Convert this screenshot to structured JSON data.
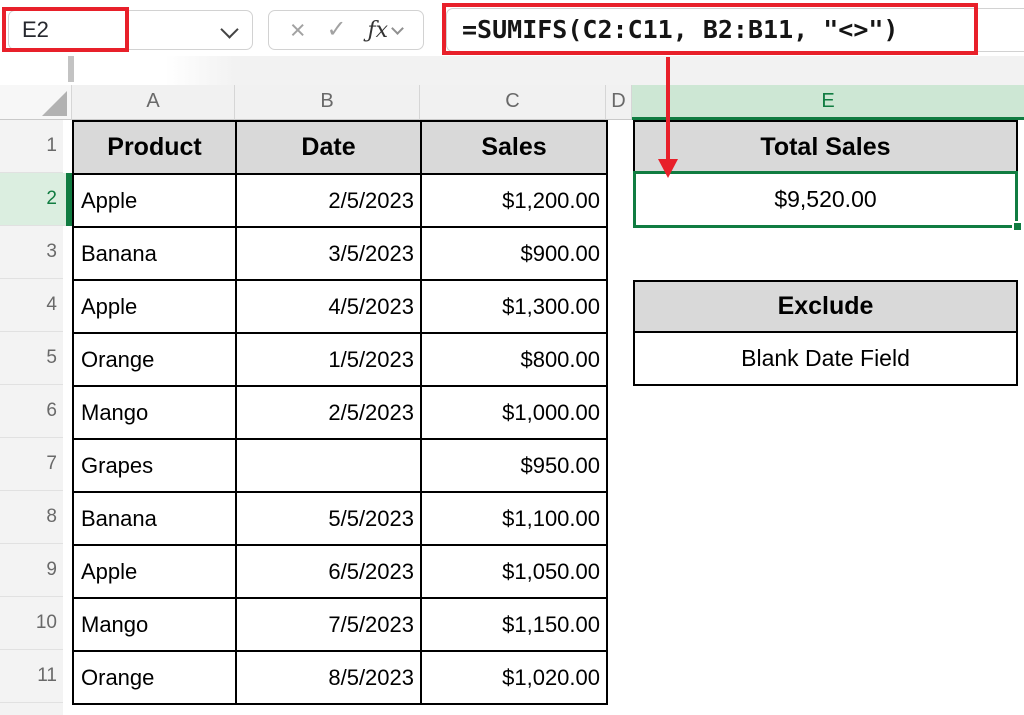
{
  "formula_bar": {
    "name_box_value": "E2",
    "formula": "=SUMIFS(C2:C11, B2:B11, \"<>\")",
    "icons": {
      "cancel": "×",
      "enter": "✓",
      "function": "ƒx"
    }
  },
  "grid": {
    "selected_cell": "E2",
    "selected_column": "E",
    "selected_row": "2",
    "column_headers": [
      "A",
      "B",
      "C",
      "D",
      "E"
    ],
    "row_headers": [
      "1",
      "2",
      "3",
      "4",
      "5",
      "6",
      "7",
      "8",
      "9",
      "10",
      "11"
    ],
    "table": {
      "headers": {
        "product": "Product",
        "date": "Date",
        "sales": "Sales"
      },
      "rows": [
        {
          "product": "Apple",
          "date": "2/5/2023",
          "sales": "$1,200.00"
        },
        {
          "product": "Banana",
          "date": "3/5/2023",
          "sales": "$900.00"
        },
        {
          "product": "Apple",
          "date": "4/5/2023",
          "sales": "$1,300.00"
        },
        {
          "product": "Orange",
          "date": "1/5/2023",
          "sales": "$800.00"
        },
        {
          "product": "Mango",
          "date": "2/5/2023",
          "sales": "$1,000.00"
        },
        {
          "product": "Grapes",
          "date": "",
          "sales": "$950.00"
        },
        {
          "product": "Banana",
          "date": "5/5/2023",
          "sales": "$1,100.00"
        },
        {
          "product": "Apple",
          "date": "6/5/2023",
          "sales": "$1,050.00"
        },
        {
          "product": "Mango",
          "date": "7/5/2023",
          "sales": "$1,150.00"
        },
        {
          "product": "Orange",
          "date": "8/5/2023",
          "sales": "$1,020.00"
        }
      ]
    }
  },
  "summary": {
    "total_sales": {
      "label": "Total Sales",
      "value": "$9,520.00"
    },
    "exclude": {
      "label": "Exclude",
      "value": "Blank Date Field"
    }
  },
  "colors": {
    "excel_green": "#107C41",
    "selected_header_fill": "#CDE7D4",
    "selected_row_header_fill": "#DBEEE0",
    "table_header_fill": "#D9D9D9",
    "annotation_red": "#E8202A"
  }
}
